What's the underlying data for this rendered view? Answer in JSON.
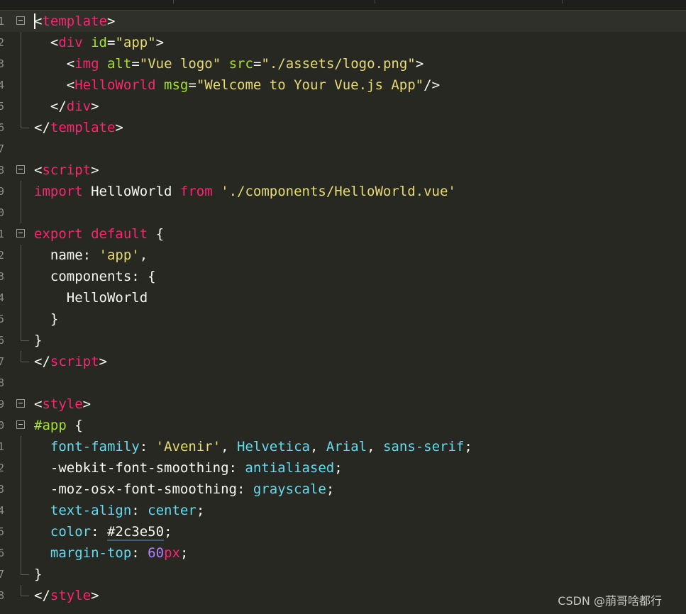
{
  "editor": {
    "theme_colors": {
      "background": "#272822",
      "tag": "#f92672",
      "attribute": "#a6e22e",
      "string": "#e6db74",
      "keyword": "#f92672",
      "property": "#66d9ef",
      "number": "#ae81ff",
      "text": "#f8f8f2"
    },
    "lines": [
      {
        "num": "1",
        "fold": "start",
        "tokens": [
          {
            "t": "<",
            "c": "plain"
          },
          {
            "t": "template",
            "c": "tag"
          },
          {
            "t": ">",
            "c": "plain"
          }
        ]
      },
      {
        "num": "2",
        "fold": "mid",
        "tokens": [
          {
            "t": "  <",
            "c": "plain"
          },
          {
            "t": "div",
            "c": "tag"
          },
          {
            "t": " ",
            "c": "plain"
          },
          {
            "t": "id",
            "c": "attr"
          },
          {
            "t": "=",
            "c": "plain"
          },
          {
            "t": "\"app\"",
            "c": "str"
          },
          {
            "t": ">",
            "c": "plain"
          }
        ]
      },
      {
        "num": "3",
        "fold": "mid",
        "tokens": [
          {
            "t": "    <",
            "c": "plain"
          },
          {
            "t": "img",
            "c": "tag"
          },
          {
            "t": " ",
            "c": "plain"
          },
          {
            "t": "alt",
            "c": "attr"
          },
          {
            "t": "=",
            "c": "plain"
          },
          {
            "t": "\"Vue logo\"",
            "c": "str"
          },
          {
            "t": " ",
            "c": "plain"
          },
          {
            "t": "src",
            "c": "attr"
          },
          {
            "t": "=",
            "c": "plain"
          },
          {
            "t": "\"./assets/logo.png\"",
            "c": "str"
          },
          {
            "t": ">",
            "c": "plain"
          }
        ]
      },
      {
        "num": "4",
        "fold": "mid",
        "tokens": [
          {
            "t": "    <",
            "c": "plain"
          },
          {
            "t": "HelloWorld",
            "c": "tag"
          },
          {
            "t": " ",
            "c": "plain"
          },
          {
            "t": "msg",
            "c": "attr"
          },
          {
            "t": "=",
            "c": "plain"
          },
          {
            "t": "\"Welcome to Your Vue.js App\"",
            "c": "str"
          },
          {
            "t": "/>",
            "c": "plain"
          }
        ]
      },
      {
        "num": "5",
        "fold": "mid",
        "tokens": [
          {
            "t": "  </",
            "c": "plain"
          },
          {
            "t": "div",
            "c": "tag"
          },
          {
            "t": ">",
            "c": "plain"
          }
        ]
      },
      {
        "num": "6",
        "fold": "end",
        "tokens": [
          {
            "t": "</",
            "c": "plain"
          },
          {
            "t": "template",
            "c": "tag"
          },
          {
            "t": ">",
            "c": "plain"
          }
        ]
      },
      {
        "num": "7",
        "fold": "none",
        "tokens": []
      },
      {
        "num": "8",
        "fold": "start",
        "tokens": [
          {
            "t": "<",
            "c": "plain"
          },
          {
            "t": "script",
            "c": "tag"
          },
          {
            "t": ">",
            "c": "plain"
          }
        ]
      },
      {
        "num": "9",
        "fold": "mid",
        "tokens": [
          {
            "t": "import",
            "c": "kw"
          },
          {
            "t": " HelloWorld ",
            "c": "plain"
          },
          {
            "t": "from",
            "c": "kw"
          },
          {
            "t": " ",
            "c": "plain"
          },
          {
            "t": "'./components/HelloWorld.vue'",
            "c": "str"
          }
        ]
      },
      {
        "num": "0",
        "fold": "mid",
        "tokens": []
      },
      {
        "num": "1",
        "fold": "start",
        "tokens": [
          {
            "t": "export",
            "c": "kw"
          },
          {
            "t": " ",
            "c": "plain"
          },
          {
            "t": "default",
            "c": "kw"
          },
          {
            "t": " {",
            "c": "plain"
          }
        ]
      },
      {
        "num": "2",
        "fold": "mid",
        "tokens": [
          {
            "t": "  name: ",
            "c": "plain"
          },
          {
            "t": "'app'",
            "c": "str"
          },
          {
            "t": ",",
            "c": "plain"
          }
        ]
      },
      {
        "num": "3",
        "fold": "mid",
        "tokens": [
          {
            "t": "  components: {",
            "c": "plain"
          }
        ]
      },
      {
        "num": "4",
        "fold": "mid",
        "tokens": [
          {
            "t": "    HelloWorld",
            "c": "plain"
          }
        ]
      },
      {
        "num": "5",
        "fold": "mid",
        "tokens": [
          {
            "t": "  }",
            "c": "plain"
          }
        ]
      },
      {
        "num": "6",
        "fold": "end",
        "tokens": [
          {
            "t": "}",
            "c": "plain"
          }
        ]
      },
      {
        "num": "7",
        "fold": "end",
        "tokens": [
          {
            "t": "</",
            "c": "plain"
          },
          {
            "t": "script",
            "c": "tag"
          },
          {
            "t": ">",
            "c": "plain"
          }
        ]
      },
      {
        "num": "8",
        "fold": "none",
        "tokens": []
      },
      {
        "num": "9",
        "fold": "start",
        "tokens": [
          {
            "t": "<",
            "c": "plain"
          },
          {
            "t": "style",
            "c": "tag"
          },
          {
            "t": ">",
            "c": "plain"
          }
        ]
      },
      {
        "num": "0",
        "fold": "start",
        "tokens": [
          {
            "t": "#app",
            "c": "sel"
          },
          {
            "t": " {",
            "c": "plain"
          }
        ]
      },
      {
        "num": "1",
        "fold": "mid",
        "tokens": [
          {
            "t": "  ",
            "c": "plain"
          },
          {
            "t": "font-family",
            "c": "prop"
          },
          {
            "t": ": ",
            "c": "plain"
          },
          {
            "t": "'Avenir'",
            "c": "str"
          },
          {
            "t": ", ",
            "c": "plain"
          },
          {
            "t": "Helvetica",
            "c": "prop"
          },
          {
            "t": ", ",
            "c": "plain"
          },
          {
            "t": "Arial",
            "c": "prop"
          },
          {
            "t": ", ",
            "c": "plain"
          },
          {
            "t": "sans-serif",
            "c": "prop"
          },
          {
            "t": ";",
            "c": "plain"
          }
        ]
      },
      {
        "num": "2",
        "fold": "mid",
        "tokens": [
          {
            "t": "  -webkit-font-smoothing: ",
            "c": "plain"
          },
          {
            "t": "antialiased",
            "c": "prop"
          },
          {
            "t": ";",
            "c": "plain"
          }
        ]
      },
      {
        "num": "3",
        "fold": "mid",
        "tokens": [
          {
            "t": "  -moz-osx-font-smoothing: ",
            "c": "plain"
          },
          {
            "t": "grayscale",
            "c": "prop"
          },
          {
            "t": ";",
            "c": "plain"
          }
        ]
      },
      {
        "num": "4",
        "fold": "mid",
        "tokens": [
          {
            "t": "  ",
            "c": "plain"
          },
          {
            "t": "text-align",
            "c": "prop"
          },
          {
            "t": ": ",
            "c": "plain"
          },
          {
            "t": "center",
            "c": "prop"
          },
          {
            "t": ";",
            "c": "plain"
          }
        ]
      },
      {
        "num": "5",
        "fold": "mid",
        "tokens": [
          {
            "t": "  ",
            "c": "plain"
          },
          {
            "t": "color",
            "c": "prop"
          },
          {
            "t": ": ",
            "c": "plain"
          },
          {
            "t": "#2c3e50",
            "c": "color"
          },
          {
            "t": ";",
            "c": "plain"
          }
        ]
      },
      {
        "num": "6",
        "fold": "mid",
        "tokens": [
          {
            "t": "  ",
            "c": "plain"
          },
          {
            "t": "margin-top",
            "c": "prop"
          },
          {
            "t": ": ",
            "c": "plain"
          },
          {
            "t": "60",
            "c": "num"
          },
          {
            "t": "px",
            "c": "unit"
          },
          {
            "t": ";",
            "c": "plain"
          }
        ]
      },
      {
        "num": "7",
        "fold": "end",
        "tokens": [
          {
            "t": "}",
            "c": "plain"
          }
        ]
      },
      {
        "num": "8",
        "fold": "end",
        "tokens": [
          {
            "t": "</",
            "c": "plain"
          },
          {
            "t": "style",
            "c": "tag"
          },
          {
            "t": ">",
            "c": "plain"
          }
        ]
      }
    ]
  },
  "watermark": "CSDN @萠哥啥都行"
}
